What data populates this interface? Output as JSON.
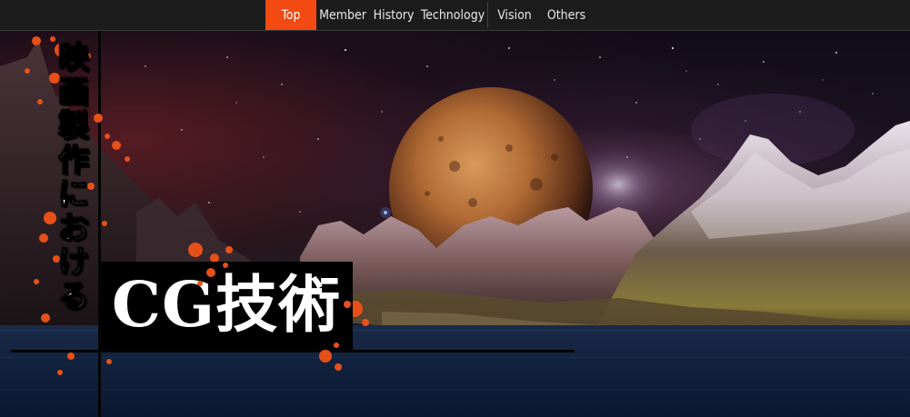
{
  "nav": {
    "items": [
      {
        "label": "Top",
        "active": true
      },
      {
        "label": "Member",
        "active": false
      },
      {
        "label": "History",
        "active": false
      },
      {
        "label": "Technology",
        "active": false
      },
      {
        "label": "Vision",
        "active": false
      },
      {
        "label": "Others",
        "active": false
      }
    ]
  },
  "hero": {
    "title_vertical": [
      "映",
      "画",
      "製",
      "作",
      "に",
      "お",
      "け",
      "る"
    ],
    "title_cg": "CG技術"
  },
  "colors": {
    "accent": "#f24a12",
    "nav_bg": "#1c1c1c",
    "title_text": "#ffffff",
    "title_box": "#000000"
  },
  "icons": {
    "paint_splatter": "decorative-splatter"
  }
}
